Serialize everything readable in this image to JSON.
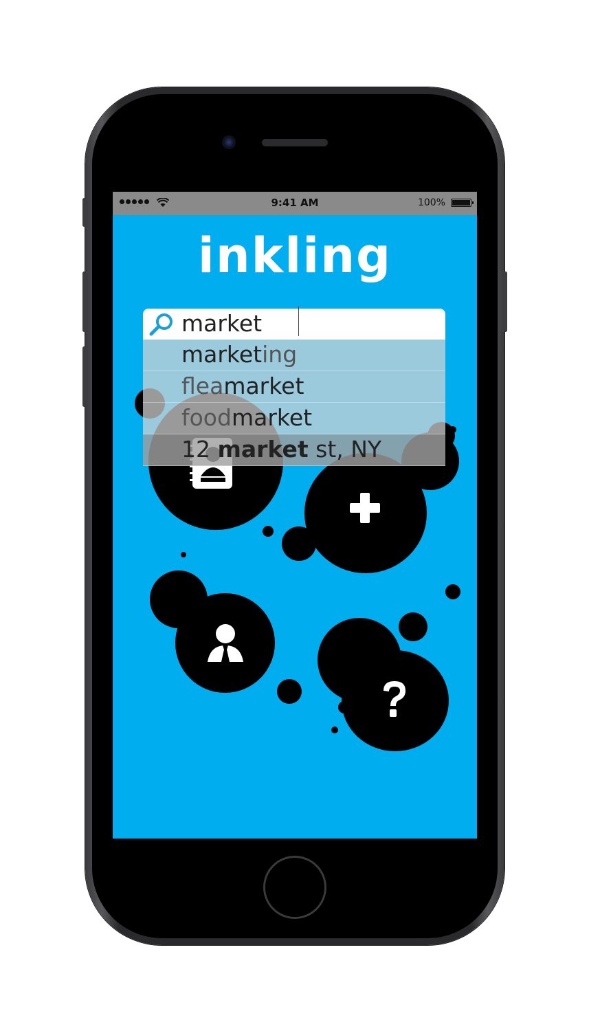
{
  "status_bar": {
    "time": "9:41 AM",
    "battery": "100%"
  },
  "app": {
    "logo": "inkling"
  },
  "search": {
    "query": "market",
    "suggestions": [
      {
        "prefix": "",
        "match": "market",
        "suffix": "ing"
      },
      {
        "prefix": "flea",
        "match": "market",
        "suffix": ""
      },
      {
        "prefix": "food",
        "match": "market",
        "suffix": ""
      },
      {
        "prefix": "12 ",
        "match": "market",
        "suffix": " st, NY"
      }
    ]
  },
  "menu_icons": [
    "notebook-icon",
    "plus-icon",
    "person-icon",
    "help-icon"
  ],
  "colors": {
    "screen_bg": "#00adee",
    "ink": "#000000",
    "accent": "#1ba1d8"
  }
}
